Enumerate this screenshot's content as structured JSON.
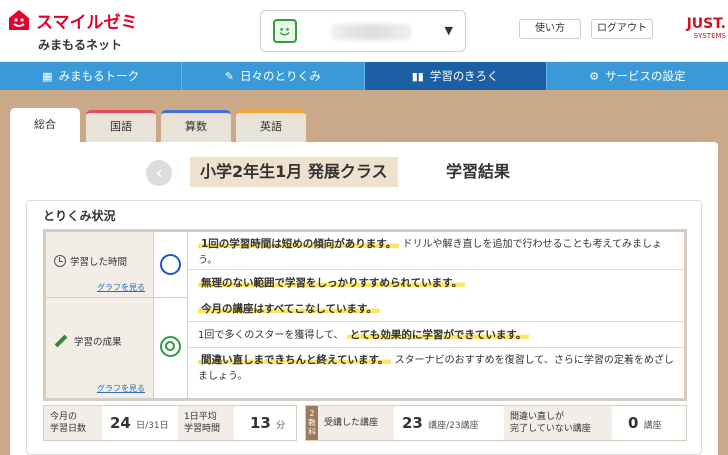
{
  "header": {
    "logo_main": "スマイルゼミ",
    "logo_sub": "みまもるネット",
    "child_avatar_icon": "smile-face-icon",
    "howto_label": "使い方",
    "logout_label": "ログアウト",
    "just_main": "JUST.",
    "just_sub": "SYSTEMS"
  },
  "nav": {
    "items": [
      {
        "label": "みまもるトーク",
        "icon": "▦"
      },
      {
        "label": "日々のとりくみ",
        "icon": "✎"
      },
      {
        "label": "学習のきろく",
        "icon": "▮▮"
      },
      {
        "label": "サービスの設定",
        "icon": "⚙"
      }
    ],
    "active_index": 2
  },
  "tabs": {
    "general": "総合",
    "kokugo": "国語",
    "sansu": "算数",
    "eigo": "英語"
  },
  "title": {
    "back": "‹",
    "chip": "小学2年生1月 発展クラス",
    "suffix": "学習結果"
  },
  "status": {
    "heading": "とりくみ状況",
    "time_label": "学習した時間",
    "time_link": "グラフを見る",
    "result_label": "学習の成果",
    "result_link": "グラフを見る",
    "c1_hl": "1回の学習時間は短めの傾向があります。",
    "c1_text": "ドリルや解き直しを追加で行わせることも考えてみましょう。",
    "c2_hl": "無理のない範囲で学習をしっかりすすめられています。",
    "c3_hl": "今月の講座はすべてこなしています。",
    "c4_text": "1回で多くのスターを獲得して、",
    "c4_hl": "とても効果的に学習ができています。",
    "c5_hl": "間違い直しまできちんと終えています。",
    "c5_text": "スターナビのおすすめを復習して、さらに学習の定着をめざしましょう。"
  },
  "stats": {
    "days_label_1": "今月の",
    "days_label_2": "学習日数",
    "days_value": "24",
    "days_unit": "日/31日",
    "avg_label_1": "1日平均",
    "avg_label_2": "学習時間",
    "avg_value": "13",
    "avg_unit": "分",
    "vlabel": "2教科",
    "courses_label": "受講した講座",
    "courses_value": "23",
    "courses_unit": "講座/23講座",
    "review_label_1": "間違い直しが",
    "review_label_2": "完了していない講座",
    "review_value": "0",
    "review_unit": "講座"
  },
  "colors": {
    "nav_bg": "#3a9ad9",
    "nav_active": "#1b5fa5",
    "brand_red": "#e6002d",
    "highlight": "#ffe566",
    "bg_brown": "#c9a987"
  }
}
